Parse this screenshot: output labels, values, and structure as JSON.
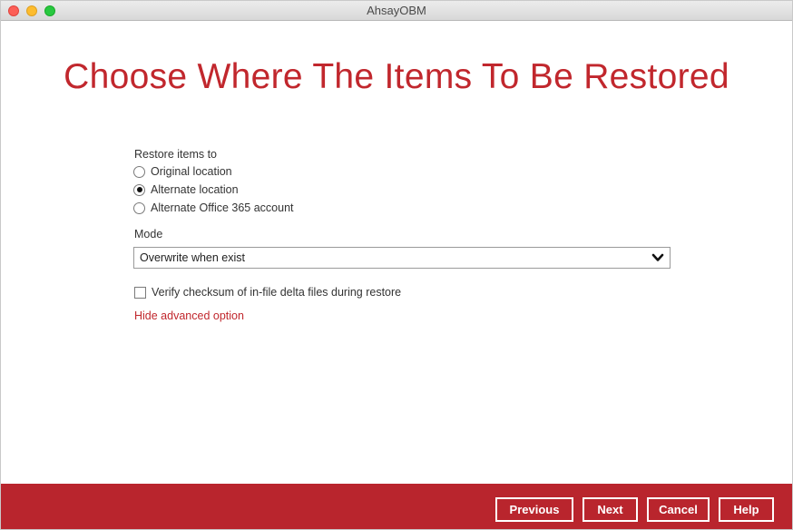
{
  "window": {
    "title": "AhsayOBM"
  },
  "page": {
    "title": "Choose Where The Items To Be Restored"
  },
  "restore": {
    "label": "Restore items to",
    "options": [
      {
        "label": "Original location",
        "selected": false
      },
      {
        "label": "Alternate location",
        "selected": true
      },
      {
        "label": "Alternate Office 365 account",
        "selected": false
      }
    ]
  },
  "mode": {
    "label": "Mode",
    "selected": "Overwrite when exist"
  },
  "verify_checksum": {
    "label": "Verify checksum of in-file delta files during restore",
    "checked": false
  },
  "advanced_link": "Hide advanced option",
  "footer": {
    "buttons": {
      "previous": "Previous",
      "next": "Next",
      "cancel": "Cancel",
      "help": "Help"
    }
  },
  "colors": {
    "accent": "#c1272d",
    "footer_bg": "#b9252d"
  },
  "icons": {
    "dropdown": "chevron-down-icon"
  }
}
